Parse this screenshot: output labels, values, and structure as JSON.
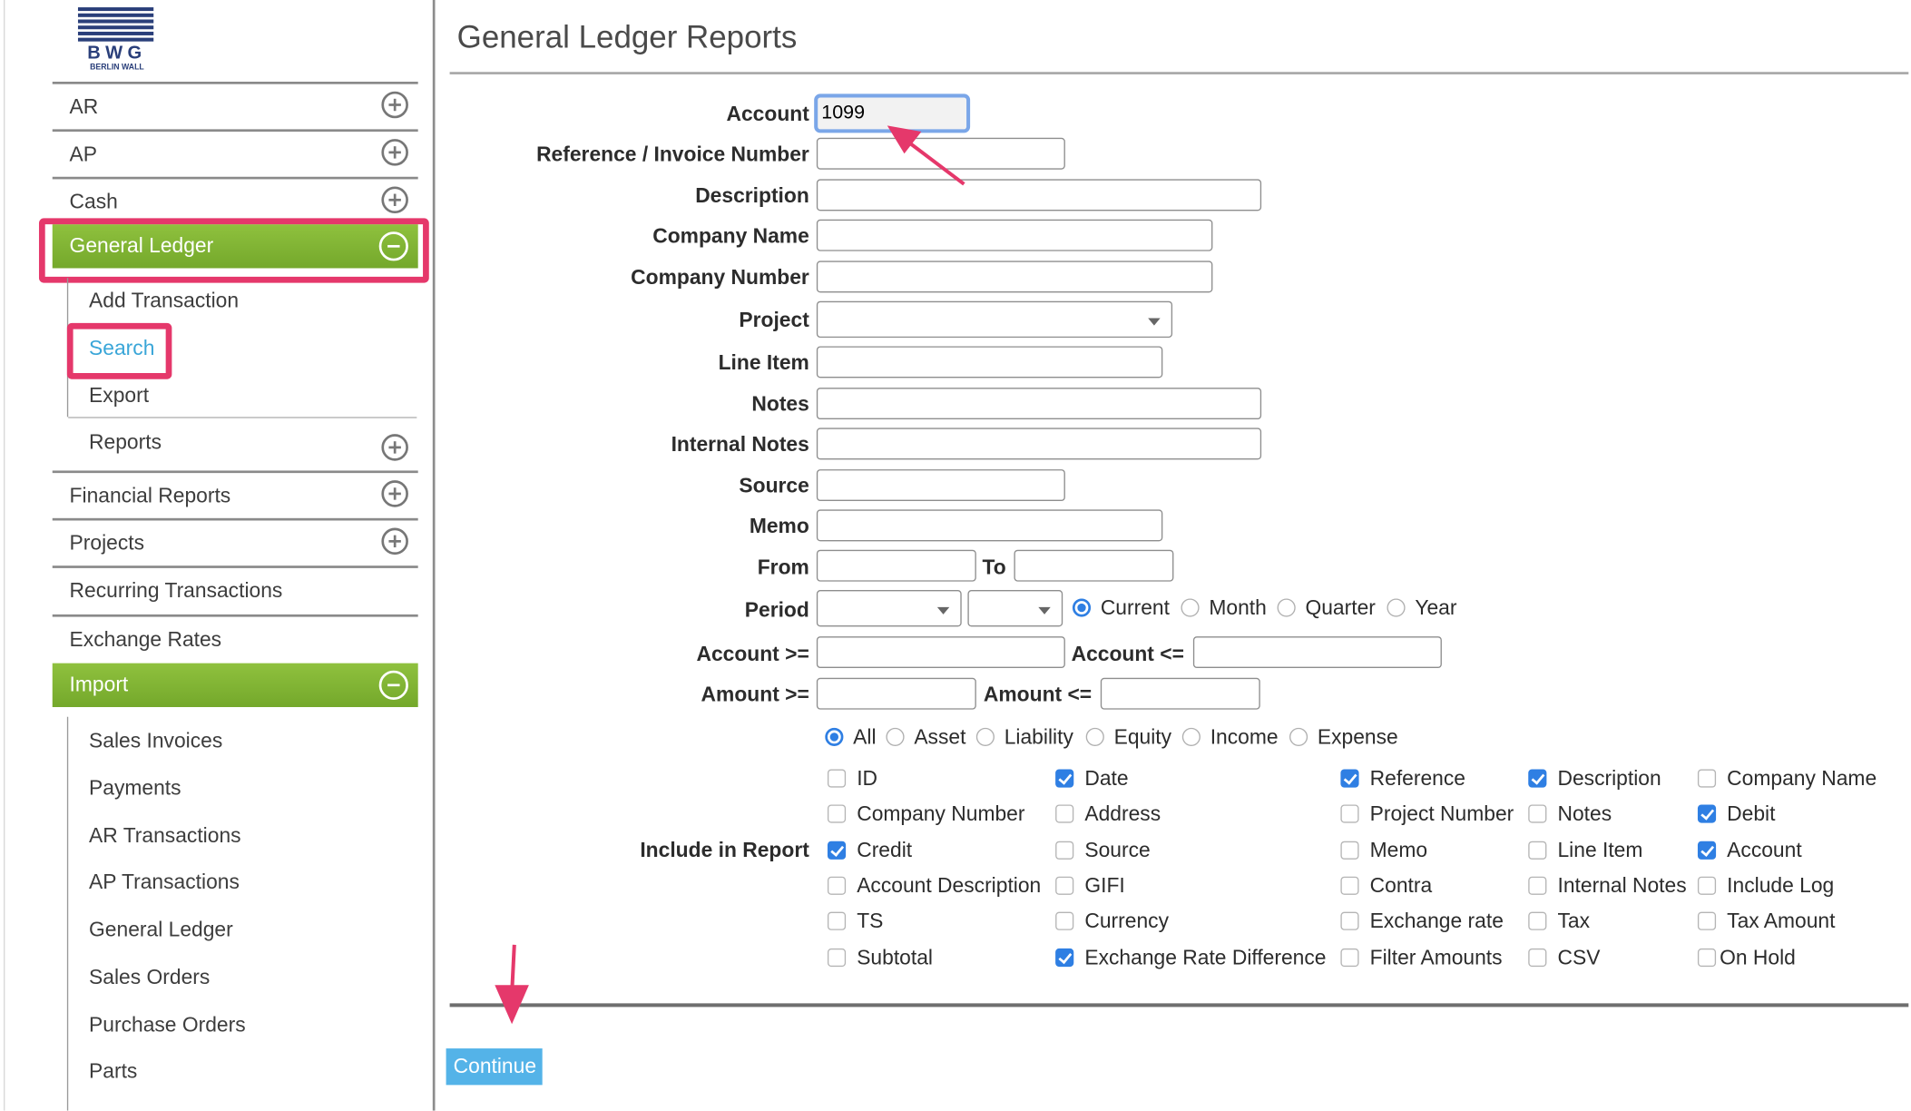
{
  "logo": {
    "brand": "BWG",
    "sub": "BERLIN WALL"
  },
  "sidebar": {
    "items": [
      {
        "label": "AR",
        "expand": "plus"
      },
      {
        "label": "AP",
        "expand": "plus"
      },
      {
        "label": "Cash",
        "expand": "plus"
      },
      {
        "label": "General Ledger",
        "expand": "minus",
        "active": true
      },
      {
        "label": "Financial Reports",
        "expand": "plus"
      },
      {
        "label": "Projects",
        "expand": "plus"
      },
      {
        "label": "Recurring Transactions"
      },
      {
        "label": "Exchange Rates"
      },
      {
        "label": "Import",
        "expand": "minus",
        "active": true
      }
    ],
    "general_ledger_sub": [
      {
        "label": "Add Transaction"
      },
      {
        "label": "Search",
        "selected": true
      },
      {
        "label": "Export"
      },
      {
        "label": "Reports",
        "expand": "plus"
      }
    ],
    "import_sub": [
      {
        "label": "Sales Invoices"
      },
      {
        "label": "Payments"
      },
      {
        "label": "AR Transactions"
      },
      {
        "label": "AP Transactions"
      },
      {
        "label": "General Ledger"
      },
      {
        "label": "Sales Orders"
      },
      {
        "label": "Purchase Orders"
      },
      {
        "label": "Parts"
      }
    ]
  },
  "page": {
    "title": "General Ledger Reports"
  },
  "form": {
    "account": {
      "label": "Account",
      "value": "1099"
    },
    "reference": {
      "label": "Reference / Invoice Number",
      "value": ""
    },
    "description": {
      "label": "Description",
      "value": ""
    },
    "company_name": {
      "label": "Company Name",
      "value": ""
    },
    "company_number": {
      "label": "Company Number",
      "value": ""
    },
    "project": {
      "label": "Project",
      "value": ""
    },
    "line_item": {
      "label": "Line Item",
      "value": ""
    },
    "notes": {
      "label": "Notes",
      "value": ""
    },
    "internal_notes": {
      "label": "Internal Notes",
      "value": ""
    },
    "source": {
      "label": "Source",
      "value": ""
    },
    "memo": {
      "label": "Memo",
      "value": ""
    },
    "from": {
      "label": "From",
      "value": ""
    },
    "to": {
      "label": "To",
      "value": ""
    },
    "period": {
      "label": "Period",
      "options": [
        {
          "label": "Current",
          "selected": true
        },
        {
          "label": "Month",
          "selected": false
        },
        {
          "label": "Quarter",
          "selected": false
        },
        {
          "label": "Year",
          "selected": false
        }
      ]
    },
    "account_gte": {
      "label": "Account >=",
      "value": ""
    },
    "account_lte": {
      "label": "Account <=",
      "value": ""
    },
    "amount_gte": {
      "label": "Amount >=",
      "value": ""
    },
    "amount_lte": {
      "label": "Amount <=",
      "value": ""
    },
    "account_type": [
      {
        "label": "All",
        "selected": true
      },
      {
        "label": "Asset",
        "selected": false
      },
      {
        "label": "Liability",
        "selected": false
      },
      {
        "label": "Equity",
        "selected": false
      },
      {
        "label": "Income",
        "selected": false
      },
      {
        "label": "Expense",
        "selected": false
      }
    ],
    "include_label": "Include in Report",
    "include": [
      [
        {
          "label": "ID",
          "checked": false
        },
        {
          "label": "Date",
          "checked": true
        },
        {
          "label": "Reference",
          "checked": true
        },
        {
          "label": "Description",
          "checked": true
        },
        {
          "label": "Company Name",
          "checked": false
        }
      ],
      [
        {
          "label": "Company Number",
          "checked": false
        },
        {
          "label": "Address",
          "checked": false
        },
        {
          "label": "Project Number",
          "checked": false
        },
        {
          "label": "Notes",
          "checked": false
        },
        {
          "label": "Debit",
          "checked": true
        }
      ],
      [
        {
          "label": "Credit",
          "checked": true
        },
        {
          "label": "Source",
          "checked": false
        },
        {
          "label": "Memo",
          "checked": false
        },
        {
          "label": "Line Item",
          "checked": false
        },
        {
          "label": "Account",
          "checked": true
        }
      ],
      [
        {
          "label": "Account Description",
          "checked": false
        },
        {
          "label": "GIFI",
          "checked": false
        },
        {
          "label": "Contra",
          "checked": false
        },
        {
          "label": "Internal Notes",
          "checked": false
        },
        {
          "label": "Include Log",
          "checked": false
        }
      ],
      [
        {
          "label": "TS",
          "checked": false
        },
        {
          "label": "Currency",
          "checked": false
        },
        {
          "label": "Exchange rate",
          "checked": false
        },
        {
          "label": "Tax",
          "checked": false
        },
        {
          "label": "Tax Amount",
          "checked": false
        }
      ],
      [
        {
          "label": "Subtotal",
          "checked": false
        },
        {
          "label": "Exchange Rate Difference",
          "checked": true
        },
        {
          "label": "Filter Amounts",
          "checked": false
        },
        {
          "label": "CSV",
          "checked": false
        },
        {
          "label": "On Hold",
          "checked": false
        }
      ]
    ],
    "continue_label": "Continue"
  },
  "colors": {
    "accent_green": "#7fb534",
    "highlight_pink": "#e5386b",
    "checkbox_blue": "#2f7fe3",
    "button_blue": "#54b3e8"
  }
}
